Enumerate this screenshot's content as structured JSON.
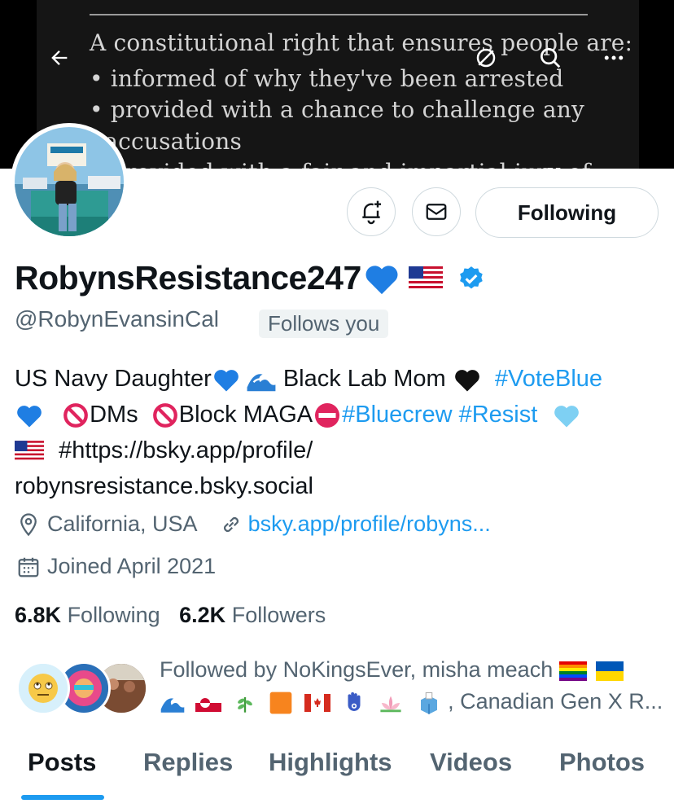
{
  "banner": {
    "lines": [
      "A constitutional right that ensures people are:",
      "• informed of why they've been arrested",
      "• provided with a chance to challenge any",
      "  accusations",
      "• provided with a fair and impartial jury of"
    ]
  },
  "header_icons": [
    "back-arrow-icon",
    "grok-icon",
    "search-icon",
    "more-icon"
  ],
  "actions": {
    "notify_icon": "bell-plus-icon",
    "message_icon": "envelope-icon",
    "following_label": "Following"
  },
  "profile": {
    "display_name": "RobynsResistance247",
    "handle": "@RobynEvansinCal",
    "follows_you": "Follows you",
    "bio": {
      "line1_a": "US Navy Daughter",
      "line1_b": " Black Lab Mom ",
      "line1_tag": "#VoteBlue",
      "line2_dms": "DMs",
      "line2_block": "Block MAGA",
      "line2_tags": "#Bluecrew #Resist",
      "line3": "#https://bsky.app/profile/",
      "line4": "robynsresistance.bsky.social"
    },
    "location": "California, USA",
    "website": "bsky.app/profile/robyns...",
    "joined": "Joined April 2021",
    "following_count": "6.8K",
    "following_label": "Following",
    "followers_count": "6.2K",
    "followers_label": "Followers"
  },
  "followed_by": {
    "line1": "Followed by NoKingsEver, misha meach",
    "line2_suffix": ", Canadian Gen X R..."
  },
  "tabs": [
    "Posts",
    "Replies",
    "Highlights",
    "Videos",
    "Photos"
  ],
  "colors": {
    "accent": "#1d9bf0",
    "verified": "#1d9bf0",
    "secondary_text": "#536471",
    "primary_text": "#0f1419"
  }
}
